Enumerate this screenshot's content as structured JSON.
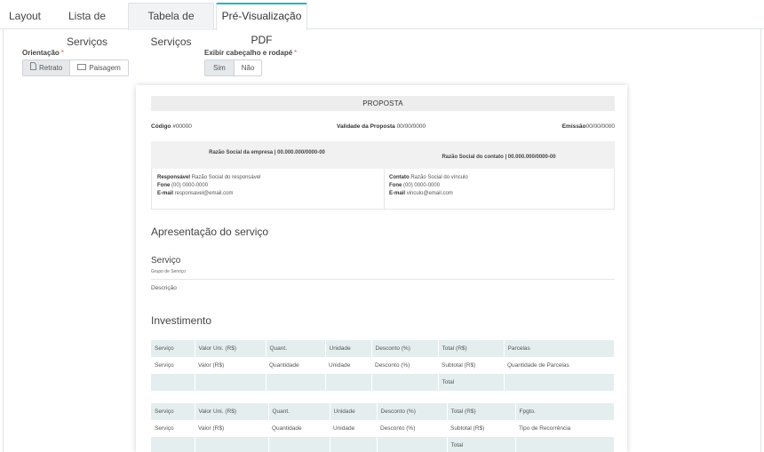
{
  "tabs": [
    {
      "label": "Layout"
    },
    {
      "label": "Lista de Serviços"
    },
    {
      "label": "Tabela de Serviços"
    },
    {
      "label": "Pré-Visualização PDF"
    }
  ],
  "controls": {
    "orientation": {
      "label": "Orientação",
      "required": "*",
      "options": [
        "Retrato",
        "Paisagem"
      ],
      "selected": "Retrato"
    },
    "header_footer": {
      "label": "Exibir cabeçalho e rodapé",
      "required": "*",
      "options": [
        "Sim",
        "Não"
      ],
      "selected": "Sim"
    }
  },
  "pdf": {
    "title": "PROPOSTA",
    "meta": {
      "code_label": "Código",
      "code_value": "#00000",
      "validity_label": "Validade da Proposta",
      "validity_value": "00/00/0000",
      "issue_label": "Emissão",
      "issue_value": "00/00/0000"
    },
    "company_header": "Razão Social da empresa | 00.000.000/0000-00",
    "contact_header": "Razão Social do contato | 00.000.000/0000-00",
    "company": {
      "resp_label": "Responsável",
      "resp_value": "Razão Social do responsável",
      "phone_label": "Fone",
      "phone_value": "(00) 0000-0000",
      "email_label": "E-mail",
      "email_value": "responsavel@email.com"
    },
    "contact": {
      "contact_label": "Contato",
      "contact_value": "Razão Social do vínculo",
      "phone_label": "Fone",
      "phone_value": "(00) 0000-0000",
      "email_label": "E-mail",
      "email_value": "vinculo@email.com"
    },
    "presentation_title": "Apresentação do serviço",
    "service_title": "Serviço",
    "service_group": "Grupo de Serviço",
    "description": "Descrição",
    "investment_title": "Investimento",
    "table1": {
      "headers": [
        "Serviço",
        "Valor Uni. (R$)",
        "Quant.",
        "Unidade",
        "Desconto (%)",
        "Total (R$)",
        "Parcelas"
      ],
      "row": [
        "Serviço",
        "Valor (R$)",
        "Quantidade",
        "Unidade",
        "Desconto (%)",
        "Subtotal (R$)",
        "Quantidade de Parcelas"
      ],
      "total": "Total"
    },
    "table2": {
      "headers": [
        "Serviço",
        "Valor Uni. (R$)",
        "Quant.",
        "Unidade",
        "Desconto (%)",
        "Total (R$)",
        "Fpgto."
      ],
      "row": [
        "Serviço",
        "Valor (R$)",
        "Quantidade",
        "Unidade",
        "Desconto (%)",
        "Subtotal (R$)",
        "Tipo de Recorrência"
      ],
      "total": "Total"
    }
  },
  "colors": {
    "accent": "#2bb3c0",
    "table_head": "#e4eeef",
    "required": "#e05a5a"
  }
}
